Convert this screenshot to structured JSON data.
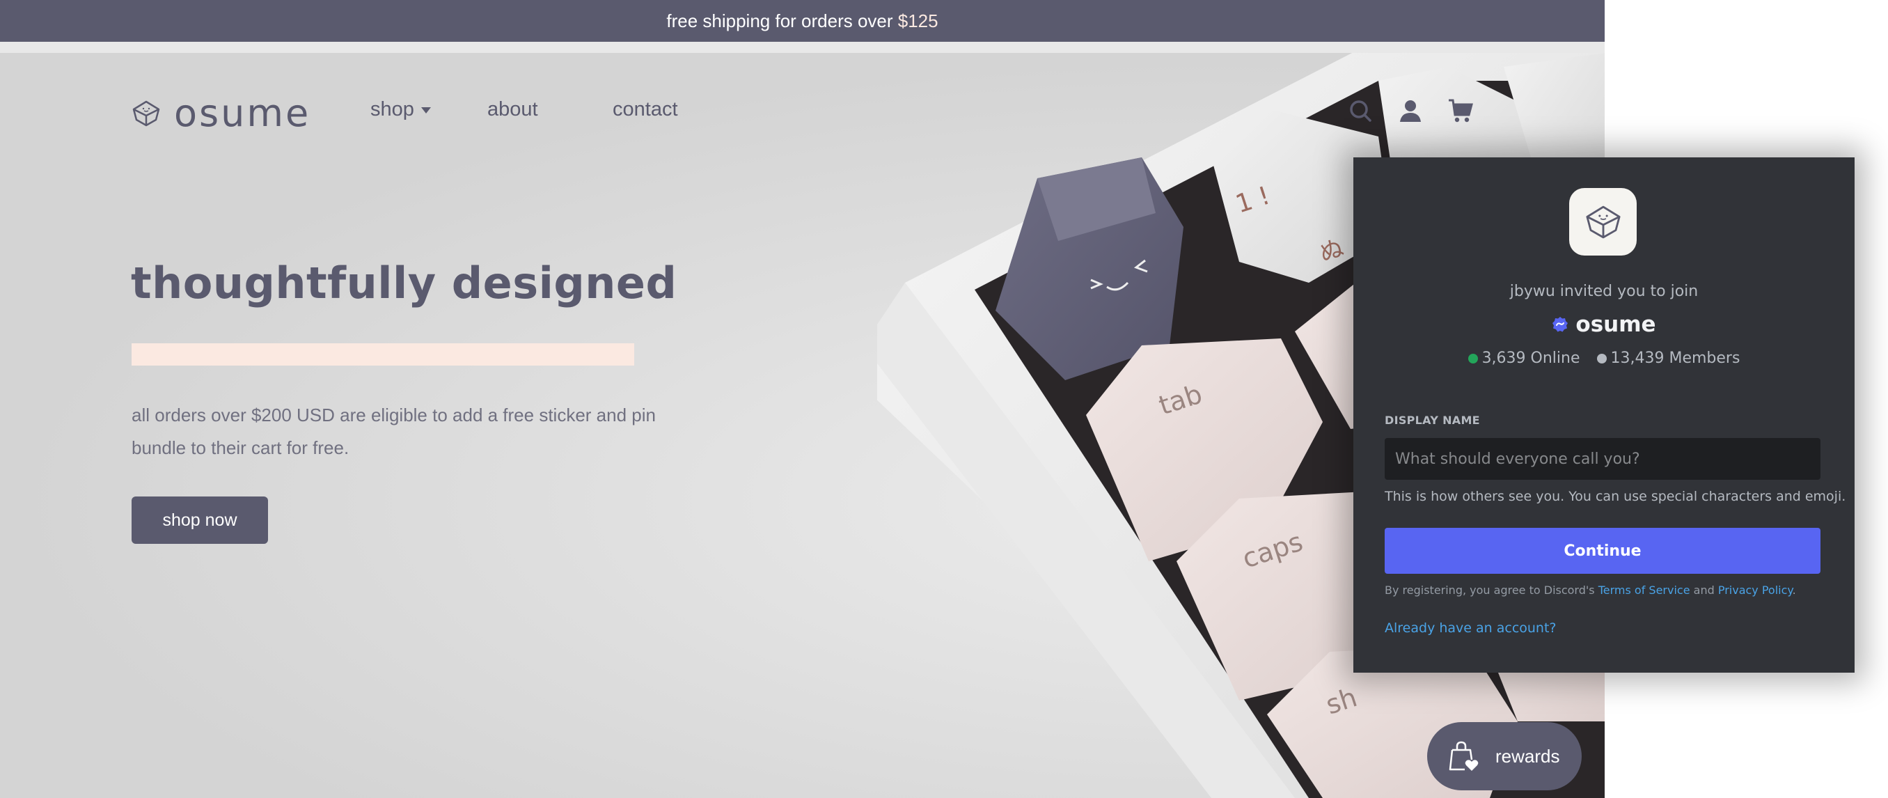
{
  "announcement": {
    "text_prefix": "free shipping for orders over ",
    "amount": "$125"
  },
  "brand": {
    "name": "osume",
    "colors": {
      "primary": "#5a5a6e",
      "accent_bar": "#fbe9e1",
      "discord_blurple": "#5865f2",
      "online_green": "#23a55a",
      "link_blue": "#4aa3e6"
    }
  },
  "nav": {
    "items": [
      {
        "label": "shop",
        "has_dropdown": true
      },
      {
        "label": "about"
      },
      {
        "label": "contact"
      }
    ],
    "icons": [
      "search-icon",
      "account-icon",
      "cart-icon"
    ]
  },
  "hero": {
    "headline": "thoughtfully designed",
    "description": "all orders over $200 USD are eligible to add a free sticker and pin bundle to their cart for free.",
    "cta_label": "shop now",
    "keycap_labels": [
      "1 !",
      "ぬ",
      "tab",
      "caps",
      "sh"
    ]
  },
  "rewards": {
    "label": "rewards",
    "icon": "shopping-bag-heart-icon"
  },
  "discord_invite": {
    "inviter_text": "jbywu invited you to join",
    "server_name": "osume",
    "verified_badge": "verified-partner-badge-icon",
    "online_count": "3,639 Online",
    "member_count": "13,439 Members",
    "display_name_label": "DISPLAY NAME",
    "display_name_value": "",
    "display_name_placeholder": "What should everyone call you?",
    "help_text": "This is how others see you. You can use special characters and emoji.",
    "continue_label": "Continue",
    "legal_prefix": "By registering, you agree to Discord's ",
    "terms_link": "Terms of Service",
    "legal_and": " and ",
    "privacy_link": "Privacy Policy",
    "legal_suffix": ".",
    "login_link": "Already have an account?"
  }
}
